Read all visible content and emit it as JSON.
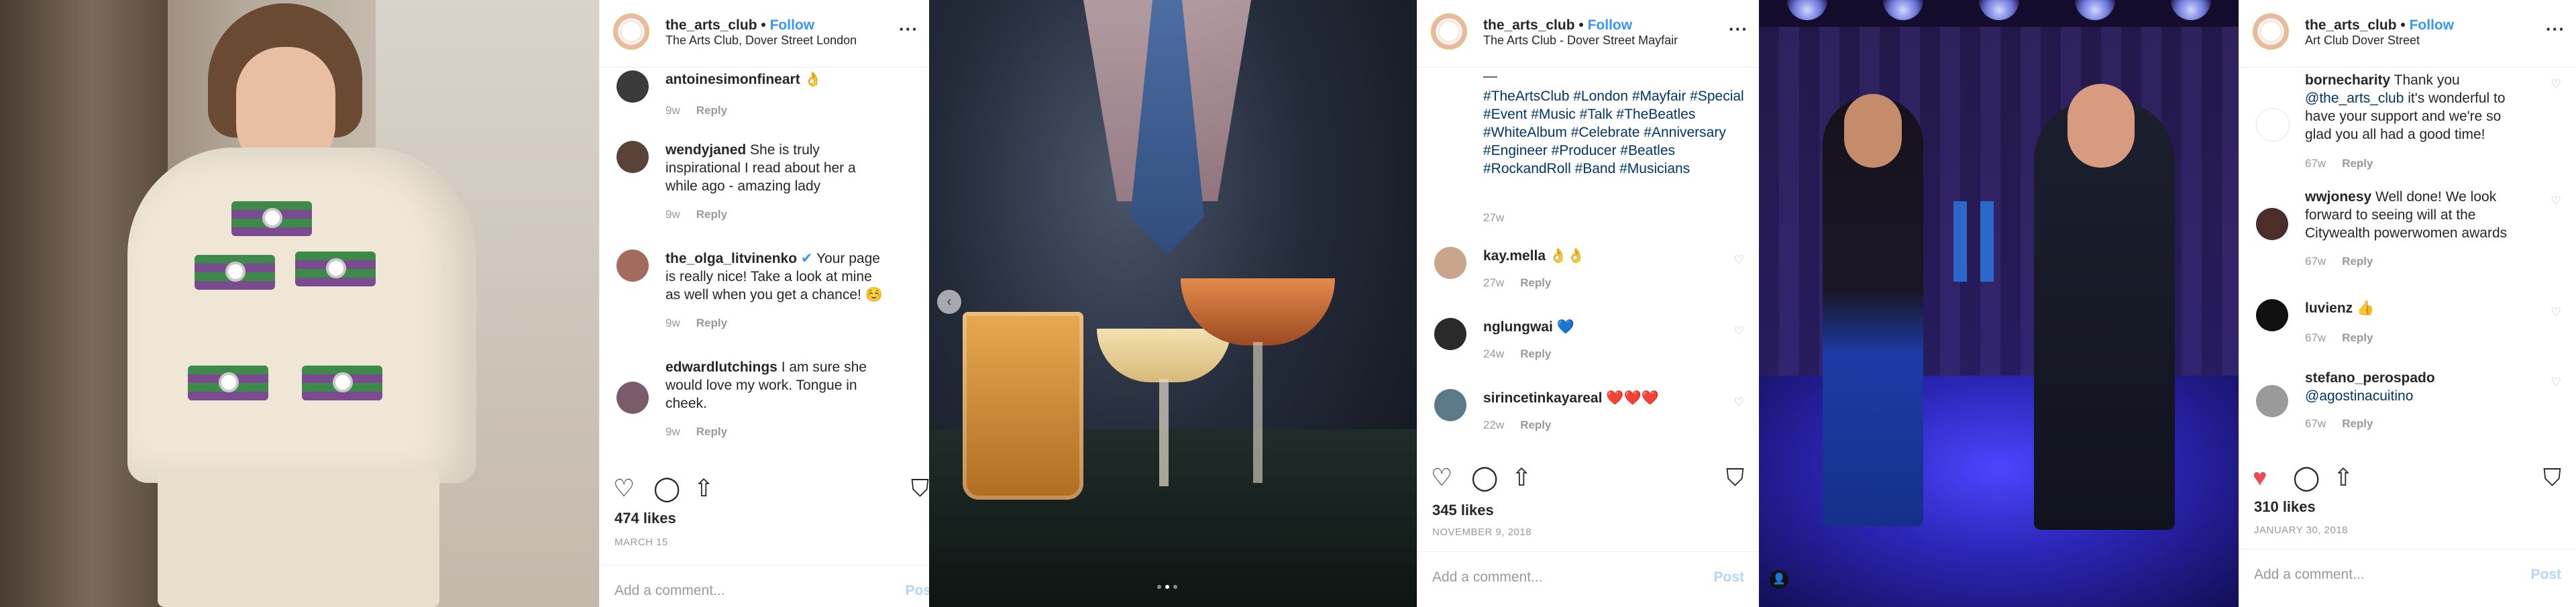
{
  "panels": [
    {
      "header": {
        "username": "the_arts_club",
        "separator": " • ",
        "follow": "Follow",
        "location": "The Arts Club, Dover Street London",
        "more": "···"
      },
      "comments": [
        {
          "user": "antoinesimonfineart",
          "text": "👌",
          "time": "9w",
          "reply": "Reply"
        },
        {
          "user": "wendyjaned",
          "text": "She is truly inspirational I read about her a while ago - amazing lady",
          "time": "9w",
          "reply": "Reply"
        },
        {
          "user": "the_olga_litvinenko",
          "verified": "✔",
          "text": "Your page is really nice! Take a look at mine as well when you get a chance! ☺️",
          "time": "9w",
          "reply": "Reply"
        },
        {
          "user": "edwardlutchings",
          "text": "I am sure she would love my work. Tongue in cheek.",
          "time": "9w",
          "reply": "Reply"
        }
      ],
      "likes": "474 likes",
      "date": "MARCH 15",
      "add_comment": "Add a comment...",
      "post": "Post"
    },
    {
      "header": {
        "username": "the_arts_club",
        "separator": " • ",
        "follow": "Follow",
        "location": "The Arts Club - Dover Street Mayfair",
        "more": "···"
      },
      "caption_dash": "—",
      "hashtags": "#TheArtsClub #London #Mayfair #Special #Event #Music #Talk #TheBeatles #WhiteAlbum #Celebrate #Anniversary #Engineer #Producer #Beatles #RockandRoll #Band #Musicians",
      "caption_time": "27w",
      "comments": [
        {
          "user": "kay.mella",
          "text": "👌👌",
          "time": "27w",
          "reply": "Reply"
        },
        {
          "user": "nglungwai",
          "text": "💙",
          "time": "24w",
          "reply": "Reply"
        },
        {
          "user": "sirincetinkayareal",
          "text": "❤️❤️❤️",
          "time": "22w",
          "reply": "Reply"
        }
      ],
      "likes": "345 likes",
      "date": "NOVEMBER 9, 2018",
      "add_comment": "Add a comment...",
      "post": "Post"
    },
    {
      "header": {
        "username": "the_arts_club",
        "separator": " • ",
        "follow": "Follow",
        "location": "Art Club Dover Street",
        "more": "···"
      },
      "comments": [
        {
          "user": "bornecharity",
          "text": "Thank you",
          "mention": "@the_arts_club",
          "text2": "it's wonderful to have your support and we're so glad you all had a good time!",
          "time": "67w",
          "reply": "Reply"
        },
        {
          "user": "wwjonesy",
          "text": "Well done! We look forward to seeing will at the Citywealth powerwomen awards",
          "time": "67w",
          "reply": "Reply"
        },
        {
          "user": "luvienz",
          "text": "👍",
          "time": "67w",
          "reply": "Reply"
        },
        {
          "user": "stefano_perospado",
          "mention": "@agostinacuitino",
          "time": "67w",
          "reply": "Reply"
        }
      ],
      "likes": "310 likes",
      "date": "JANUARY 30, 2018",
      "add_comment": "Add a comment...",
      "post": "Post"
    }
  ],
  "icons": {
    "heart": "♡",
    "heart_filled": "♥",
    "comment": "◯",
    "share": "⇧",
    "bookmark": "⛉",
    "like_small": "♡",
    "prev_arrow": "‹",
    "person": "👤"
  },
  "colors": {
    "link": "#3897f0",
    "mention": "#003569",
    "muted": "#999999",
    "liked": "#ed4956"
  }
}
